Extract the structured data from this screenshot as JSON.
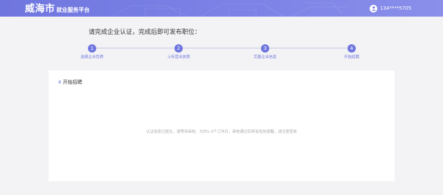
{
  "header": {
    "logo_main": "威海市",
    "logo_sub": "就业服务平台",
    "user_phone": "134****5705",
    "colors": {
      "bar": "#6f76de",
      "text": "#ffffff"
    }
  },
  "prompt": "请完成企业认证，完成后即可发布职位：",
  "steps": [
    {
      "num": "1",
      "label": "选择企业性质"
    },
    {
      "num": "2",
      "label": "上传营业执照"
    },
    {
      "num": "3",
      "label": "完善企业信息"
    },
    {
      "num": "4",
      "label": "开始招聘"
    }
  ],
  "card": {
    "title_num": "4",
    "title_text": "开始招聘",
    "message": "认证信息已提交，请等待审核，大约1-3个工作日，审核通过后将有短信提醒，请注意查收"
  },
  "accent_color": "#6f76de",
  "icons": [
    "user-avatar-icon"
  ]
}
